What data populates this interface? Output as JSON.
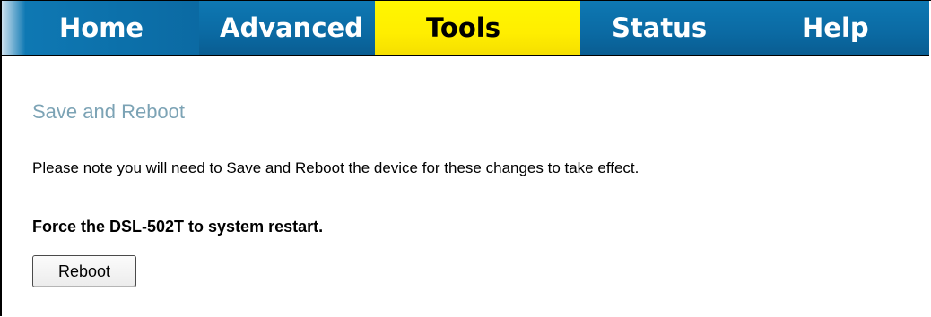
{
  "nav": {
    "tabs": [
      {
        "label": "Home"
      },
      {
        "label": "Advanced"
      },
      {
        "label": "Tools"
      },
      {
        "label": "Status"
      },
      {
        "label": "Help"
      }
    ],
    "active_tab": "Tools"
  },
  "page": {
    "title": "Save and Reboot",
    "note": "Please note you will need to Save and Reboot the device for these changes to take effect.",
    "force_label": "Force the DSL-502T to system restart.",
    "reboot_label": "Reboot"
  },
  "colors": {
    "tab_blue": "#0b6aa3",
    "tab_active_yellow": "#ffee00",
    "title_color": "#7ca3b5"
  }
}
